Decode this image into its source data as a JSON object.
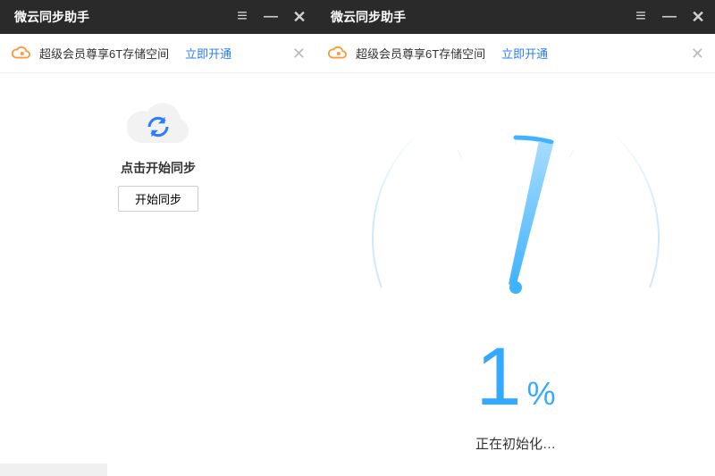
{
  "left": {
    "title": "微云同步助手",
    "banner": {
      "text": "超级会员尊享6T存储空间",
      "link": "立即开通"
    },
    "sync": {
      "label": "点击开始同步",
      "button": "开始同步"
    }
  },
  "right": {
    "title": "微云同步助手",
    "banner": {
      "text": "超级会员尊享6T存储空间",
      "link": "立即开通"
    },
    "progress": {
      "percent": "1",
      "unit": "%",
      "status": "正在初始化…"
    }
  },
  "colors": {
    "accent": "#33aaff",
    "link": "#2b7cff",
    "cloudIcon": "#ff9a3c"
  }
}
